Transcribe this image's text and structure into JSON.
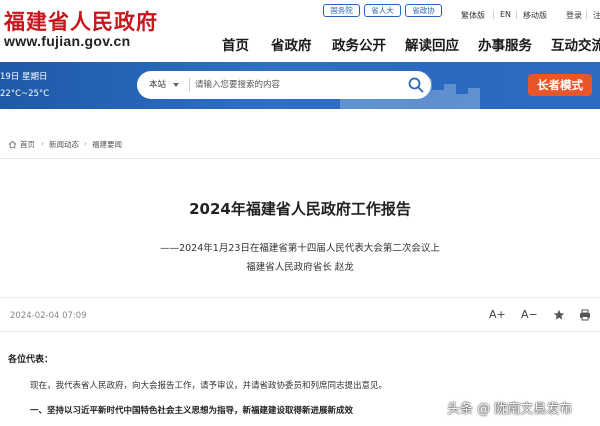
{
  "header": {
    "logo_text": "福建省人民政府",
    "logo_url": "www.fujian.gov.cn",
    "top_links": [
      {
        "label": "国务院"
      },
      {
        "label": "省人大"
      },
      {
        "label": "省政协"
      }
    ],
    "mini_links": [
      {
        "label": "繁体版"
      },
      {
        "label": "EN"
      },
      {
        "label": "移动版"
      },
      {
        "label": "登录"
      },
      {
        "label": "注"
      }
    ],
    "nav": [
      {
        "label": "首页"
      },
      {
        "label": "省政府"
      },
      {
        "label": "政务公开"
      },
      {
        "label": "解读回应"
      },
      {
        "label": "办事服务"
      },
      {
        "label": "互动交流"
      }
    ]
  },
  "banner": {
    "date": "19日 星期日",
    "weather": "22°C~25°C",
    "search_scope": "本站",
    "search_placeholder": "请输入您要搜索的内容",
    "elder_mode_label": "长者模式"
  },
  "breadcrumb": [
    {
      "label": "首页"
    },
    {
      "label": "新闻动态"
    },
    {
      "label": "福建要闻"
    }
  ],
  "article": {
    "title": "2024年福建省人民政府工作报告",
    "subtitle": "——2024年1月23日在福建省第十四届人民代表大会第二次会议上",
    "author": "福建省人民政府省长  赵龙",
    "date": "2024-02-04 07:09",
    "font_increase": "A+",
    "font_decrease": "A−",
    "salutation": "各位代表：",
    "paragraph_1": "现在，我代表省人民政府，向大会报告工作，请予审议，并请省政协委员和列席同志提出意见。",
    "heading_1": "一、坚持以习近平新时代中国特色社会主义思想为指导，新福建建设取得新进展新成效"
  },
  "watermark": "头条 @ 陇南文县发布",
  "colors": {
    "brand_red": "#c8161d",
    "banner_blue": "#2d70c4",
    "elder_orange": "#e8562a",
    "link_blue": "#2a66b8"
  }
}
